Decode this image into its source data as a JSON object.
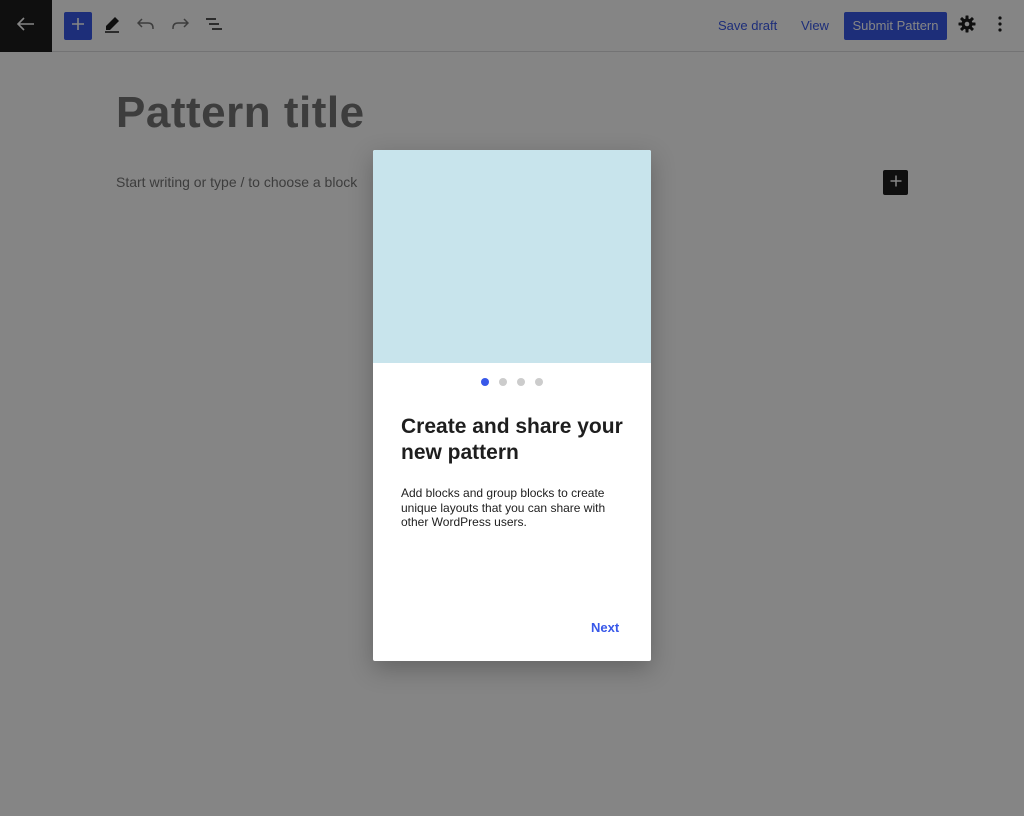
{
  "toolbar": {
    "back_icon": "arrow-left-icon",
    "inserter_icon": "plus-icon",
    "tools_icon": "pencil-icon",
    "undo_icon": "undo-icon",
    "redo_icon": "redo-icon",
    "list_view_icon": "list-view-icon",
    "save_draft_label": "Save draft",
    "view_label": "View",
    "submit_label": "Submit Pattern",
    "settings_icon": "gear-icon",
    "more_icon": "vertical-ellipsis-icon"
  },
  "editor": {
    "title_placeholder": "Pattern title",
    "block_placeholder": "Start writing or type / to choose a block",
    "add_block_icon": "plus-icon"
  },
  "guide": {
    "pages_total": 4,
    "current_page": 1,
    "heading": "Create and share your new pattern",
    "text": "Add blocks and group blocks to create unique layouts that you can share with other WordPress users.",
    "next_label": "Next"
  },
  "colors": {
    "accent": "#3858e9",
    "dark": "#1e1e1e",
    "guide_image_bg": "#c8e4ec",
    "overlay": "rgba(0,0,0,0.48)"
  }
}
